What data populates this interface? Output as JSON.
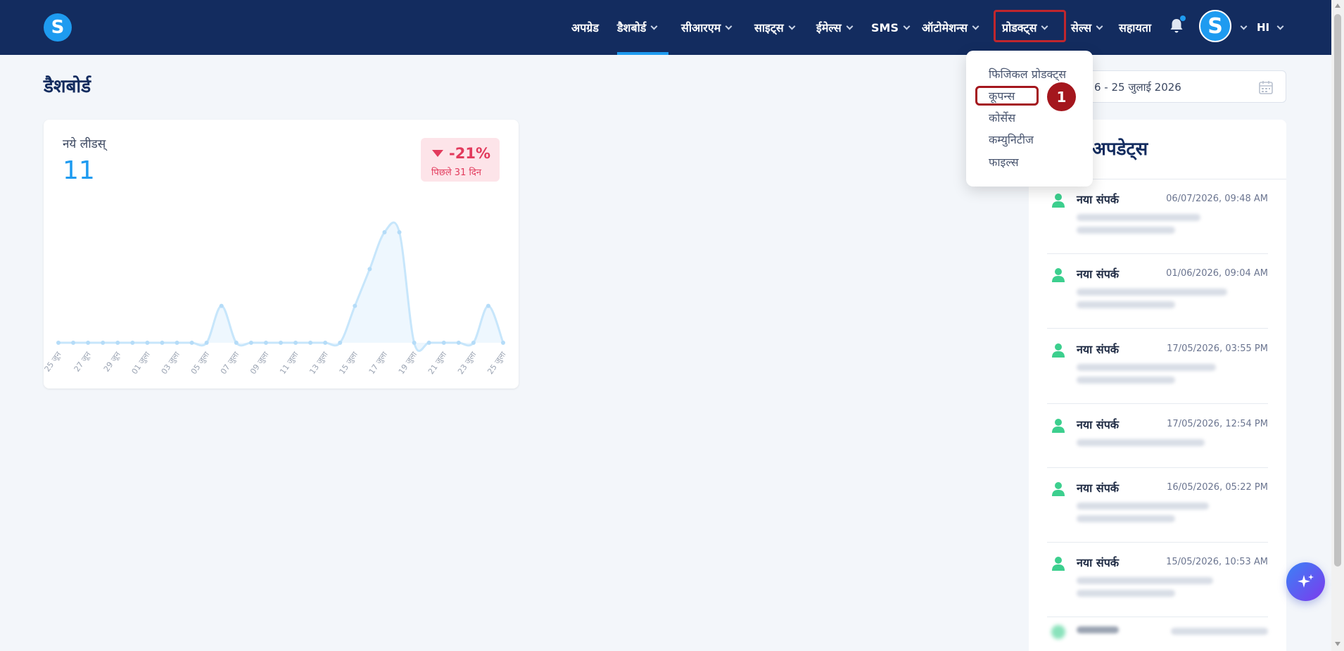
{
  "app": {
    "logo_letter": "S"
  },
  "nav": {
    "items": [
      {
        "label": "अपग्रेड",
        "has_dropdown": false
      },
      {
        "label": "डैशबोर्ड",
        "has_dropdown": true
      },
      {
        "label": "सीआरएम",
        "has_dropdown": true
      },
      {
        "label": "साइट्स",
        "has_dropdown": true
      },
      {
        "label": "ईमेल्स",
        "has_dropdown": true
      },
      {
        "label": "SMS",
        "has_dropdown": true
      },
      {
        "label": "ऑटोमेशन्स",
        "has_dropdown": true
      },
      {
        "label": "प्रोडक्ट्स",
        "has_dropdown": true
      },
      {
        "label": "सेल्स",
        "has_dropdown": true
      },
      {
        "label": "सहायता",
        "has_dropdown": false
      }
    ],
    "active": "डैशबोर्ड",
    "avatar_letter": "S",
    "language": "HI",
    "accent_color": "#1e9bf0",
    "bg_color": "#132c5f"
  },
  "page": {
    "title": "डैशबोर्ड"
  },
  "leads_card": {
    "label": "नये लीडस्",
    "value": "11",
    "change": "-21%",
    "change_period": "पिछले 31 दिन",
    "change_color": "#e23a5c"
  },
  "chart_data": {
    "type": "area",
    "title": "",
    "xlabel": "",
    "ylabel": "",
    "x": [
      "25 जून",
      "26 जून",
      "27 जून",
      "28 जून",
      "29 जून",
      "30 जून",
      "01 जुला",
      "02 जुला",
      "03 जुला",
      "04 जुला",
      "05 जुला",
      "06 जुला",
      "07 जुला",
      "08 जुला",
      "09 जुला",
      "10 जुला",
      "11 जुला",
      "12 जुला",
      "13 जुला",
      "14 जुला",
      "15 जुला",
      "16 जुला",
      "17 जुला",
      "18 जुला",
      "19 जुला",
      "20 जुला",
      "21 जुला",
      "22 जुला",
      "23 जुला",
      "24 जुला",
      "25 जुला"
    ],
    "tick_labels": [
      "25 जून",
      "27 जून",
      "29 जून",
      "01 जुला",
      "03 जुला",
      "05 जुला",
      "07 जुला",
      "09 जुला",
      "11 जुला",
      "13 जुला",
      "15 जुला",
      "17 जुला",
      "19 जुला",
      "21 जुला",
      "23 जुला",
      "25 जुला"
    ],
    "values": [
      0,
      0,
      0,
      0,
      0,
      0,
      0,
      0,
      0,
      0,
      0,
      1,
      0,
      0,
      0,
      0,
      0,
      0,
      0,
      0,
      1,
      2,
      3,
      3,
      0,
      0,
      0,
      0,
      0,
      1,
      0
    ],
    "ylim": [
      0,
      3
    ],
    "grid": false,
    "color": "#c7e6fb"
  },
  "date_range": {
    "text": "6 - 25 जुलाई 2026"
  },
  "updates": {
    "title": "अपडेट्स",
    "items": [
      {
        "title": "नया संपर्क",
        "time": "06/07/2026, 09:48 AM"
      },
      {
        "title": "नया संपर्क",
        "time": "01/06/2026, 09:04 AM"
      },
      {
        "title": "नया संपर्क",
        "time": "17/05/2026, 03:55 PM"
      },
      {
        "title": "नया संपर्क",
        "time": "17/05/2026, 12:54 PM"
      },
      {
        "title": "नया संपर्क",
        "time": "16/05/2026, 05:22 PM"
      },
      {
        "title": "नया संपर्क",
        "time": "15/05/2026, 10:53 AM"
      }
    ],
    "icon_color": "#3ccf8e"
  },
  "products_menu": {
    "items": [
      "फिजिकल प्रोडक्ट्स",
      "कूपन्स",
      "कोर्सेस",
      "कम्युनिटीज",
      "फाइल्स"
    ],
    "highlighted": "कूपन्स",
    "step_number": "1",
    "highlight_color": "#a4161d"
  }
}
